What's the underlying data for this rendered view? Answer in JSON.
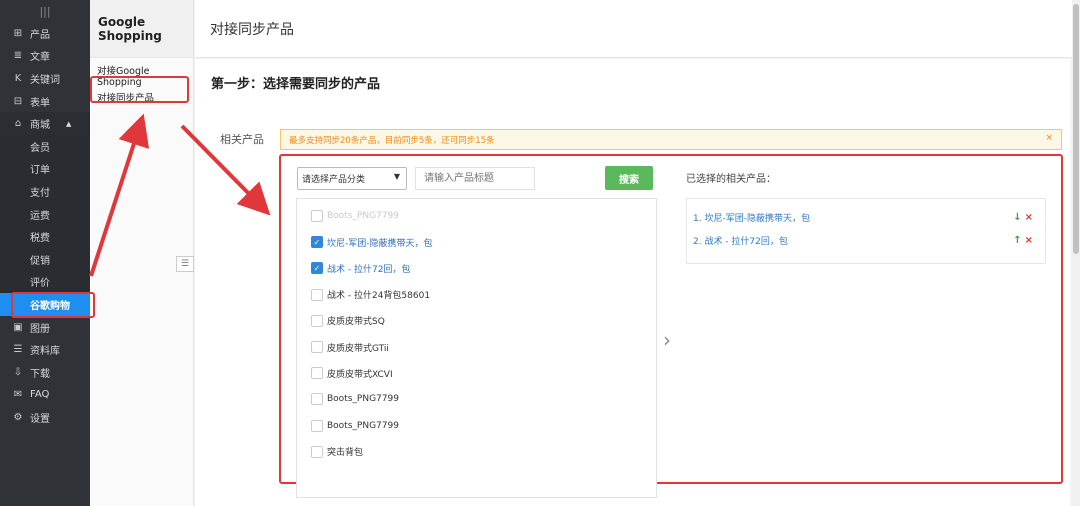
{
  "nav": {
    "top_icon": "|||",
    "items": [
      {
        "icon": "⊞",
        "label": "产品"
      },
      {
        "icon": "≣",
        "label": "文章"
      },
      {
        "icon": "K",
        "label": "关键词"
      },
      {
        "icon": "⊟",
        "label": "表单"
      },
      {
        "icon": "⌂",
        "label": "商城"
      }
    ],
    "shop_sub": [
      "会员",
      "订单",
      "支付",
      "运费",
      "税费",
      "促销",
      "评价",
      "谷歌购物"
    ],
    "bottom_items": [
      {
        "icon": "▣",
        "label": "图册"
      },
      {
        "icon": "☰",
        "label": "资料库"
      },
      {
        "icon": "⇩",
        "label": "下载"
      },
      {
        "icon": "✉",
        "label": "FAQ"
      },
      {
        "icon": "⚙",
        "label": "设置"
      }
    ],
    "accent_color": "#1f8ef1"
  },
  "menu2": {
    "title": "Google Shopping",
    "items": [
      "对接Google Shopping",
      "对接同步产品"
    ]
  },
  "header": {
    "title": "对接同步产品"
  },
  "main": {
    "step_title": "第一步：选择需要同步的产品",
    "field_label": "相关产品",
    "notice": "最多支持同步20条产品，目前同步5条，还可同步15条",
    "notice_close": "×",
    "category_select": "请选择产品分类",
    "search_placeholder": "请输入产品标题",
    "search_button": "搜索",
    "products": [
      {
        "label": "Boots_PNG7799",
        "checked": false,
        "disabled": true
      },
      {
        "label": "坎尼-军团-隐蔽携带天，包",
        "checked": true,
        "disabled": false
      },
      {
        "label": "战术 - 拉什72回，包",
        "checked": true,
        "disabled": false
      },
      {
        "label": "战术 - 拉什24背包58601",
        "checked": false,
        "disabled": false
      },
      {
        "label": "皮质皮带式SQ",
        "checked": false,
        "disabled": false
      },
      {
        "label": "皮质皮带式GTii",
        "checked": false,
        "disabled": false
      },
      {
        "label": "皮质皮带式XCVI",
        "checked": false,
        "disabled": false
      },
      {
        "label": "Boots_PNG7799",
        "checked": false,
        "disabled": false
      },
      {
        "label": "Boots_PNG7799",
        "checked": false,
        "disabled": false
      },
      {
        "label": "突击背包",
        "checked": false,
        "disabled": false
      }
    ],
    "move_arrow": "›",
    "selected_title": "已选择的相关产品：",
    "selected": [
      {
        "label": "1.  坎尼-军团-隐蔽携带天，包",
        "move": "↓",
        "remove": "×"
      },
      {
        "label": "2.  战术 - 拉什72回，包",
        "move": "↑",
        "remove": "×"
      }
    ]
  },
  "colors": {
    "highlight": "#e0373a",
    "search_button": "#5cb85c",
    "selected_link": "#2f79c4"
  }
}
